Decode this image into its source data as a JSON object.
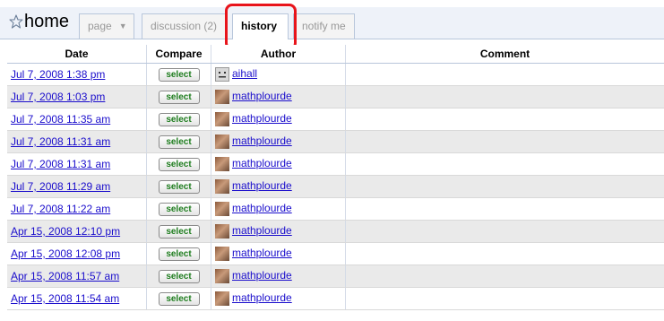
{
  "header": {
    "title": "home",
    "icon": "star-outline-icon"
  },
  "tabs": [
    {
      "label": "page",
      "has_dropdown": true
    },
    {
      "label": "discussion (2)"
    },
    {
      "label": "history",
      "active": true
    },
    {
      "label": "notify me"
    }
  ],
  "table": {
    "columns": [
      "Date",
      "Compare",
      "Author",
      "Comment"
    ],
    "rows": [
      {
        "date": "Jul 7, 2008 1:38 pm",
        "compare": "select",
        "author": "aihall",
        "avatar": "default-avatar-icon",
        "comment": ""
      },
      {
        "date": "Jul 7, 2008 1:03 pm",
        "compare": "select",
        "author": "mathplourde",
        "avatar": "photo-avatar-icon",
        "comment": ""
      },
      {
        "date": "Jul 7, 2008 11:35 am",
        "compare": "select",
        "author": "mathplourde",
        "avatar": "photo-avatar-icon",
        "comment": ""
      },
      {
        "date": "Jul 7, 2008 11:31 am",
        "compare": "select",
        "author": "mathplourde",
        "avatar": "photo-avatar-icon",
        "comment": ""
      },
      {
        "date": "Jul 7, 2008 11:31 am",
        "compare": "select",
        "author": "mathplourde",
        "avatar": "photo-avatar-icon",
        "comment": ""
      },
      {
        "date": "Jul 7, 2008 11:29 am",
        "compare": "select",
        "author": "mathplourde",
        "avatar": "photo-avatar-icon",
        "comment": ""
      },
      {
        "date": "Jul 7, 2008 11:22 am",
        "compare": "select",
        "author": "mathplourde",
        "avatar": "photo-avatar-icon",
        "comment": ""
      },
      {
        "date": "Apr 15, 2008 12:10 pm",
        "compare": "select",
        "author": "mathplourde",
        "avatar": "photo-avatar-icon",
        "comment": ""
      },
      {
        "date": "Apr 15, 2008 12:08 pm",
        "compare": "select",
        "author": "mathplourde",
        "avatar": "photo-avatar-icon",
        "comment": ""
      },
      {
        "date": "Apr 15, 2008 11:57 am",
        "compare": "select",
        "author": "mathplourde",
        "avatar": "photo-avatar-icon",
        "comment": ""
      },
      {
        "date": "Apr 15, 2008 11:54 am",
        "compare": "select",
        "author": "mathplourde",
        "avatar": "photo-avatar-icon",
        "comment": ""
      }
    ]
  },
  "colors": {
    "link": "#1a0dcc",
    "highlight": "#e8141b",
    "select_text": "#1e7d1e",
    "alt_row": "#eaeaea"
  }
}
